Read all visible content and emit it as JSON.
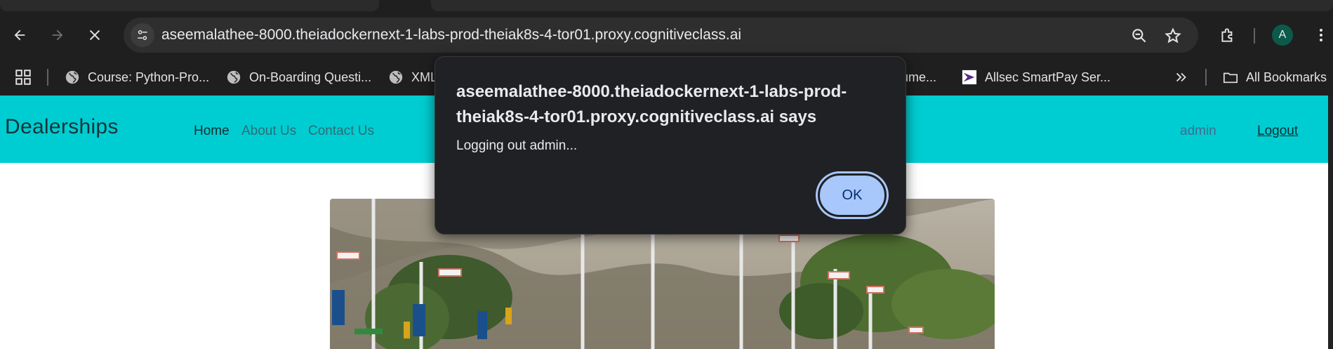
{
  "browser": {
    "url": "aseemalathee-8000.theiadockernext-1-labs-prod-theiak8s-4-tor01.proxy.cognitiveclass.ai",
    "profile_initial": "A",
    "bookmarks": [
      {
        "label": "Course: Python-Pro...",
        "icon": "globe-icon"
      },
      {
        "label": "On-Boarding Questi...",
        "icon": "globe-icon"
      },
      {
        "label": "XML",
        "icon": "globe-icon"
      },
      {
        "label": "ume...",
        "icon": "globe-icon"
      },
      {
        "label": "Allsec SmartPay Ser...",
        "icon": "allsec-icon"
      }
    ],
    "all_bookmarks_label": "All Bookmarks"
  },
  "page": {
    "brand": "Dealerships",
    "nav": [
      {
        "label": "Home"
      },
      {
        "label": "About Us"
      },
      {
        "label": "Contact Us"
      }
    ],
    "user": "admin",
    "logout": "Logout"
  },
  "dialog": {
    "title": "aseemalathee-8000.theiadockernext-1-labs-prod-theiak8s-4-tor01.proxy.cognitiveclass.ai says",
    "message": "Logging out admin...",
    "ok_label": "OK"
  },
  "colors": {
    "navbar": "#00cdd1",
    "chrome": "#1f1f1f",
    "dialog": "#202124",
    "ok_button": "#a8c7fa"
  }
}
